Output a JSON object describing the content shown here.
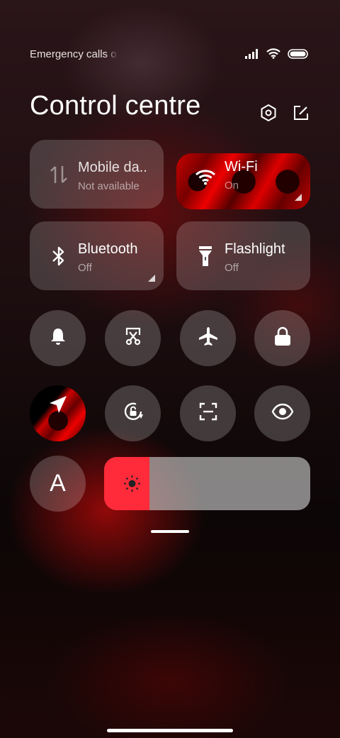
{
  "status_bar": {
    "carrier_text": "Emergency calls o",
    "icons": [
      "signal-icon",
      "wifi-icon",
      "battery-icon"
    ]
  },
  "header": {
    "title": "Control centre",
    "actions": [
      "settings-icon",
      "edit-icon"
    ]
  },
  "tiles": {
    "mobile_data": {
      "label": "Mobile da..",
      "status": "Not available"
    },
    "wifi": {
      "label": "Wi-Fi",
      "status": "On"
    },
    "bluetooth": {
      "label": "Bluetooth",
      "status": "Off"
    },
    "flashlight": {
      "label": "Flashlight",
      "status": "Off"
    }
  },
  "toggles_row1": [
    {
      "name": "ringer",
      "icon": "bell-icon"
    },
    {
      "name": "screenshot",
      "icon": "scissors-icon"
    },
    {
      "name": "airplane-mode",
      "icon": "airplane-icon"
    },
    {
      "name": "lock-screen",
      "icon": "lock-icon"
    }
  ],
  "toggles_row2": [
    {
      "name": "location",
      "icon": "location-arrow-icon",
      "active": true
    },
    {
      "name": "rotation-lock",
      "icon": "rotate-lock-icon"
    },
    {
      "name": "scanner",
      "icon": "scan-icon"
    },
    {
      "name": "reading-mode",
      "icon": "eye-icon"
    }
  ],
  "font_size_button": {
    "label": "A"
  },
  "brightness": {
    "level": 0.22,
    "icon": "sun-icon",
    "accent": "#ff2a3a"
  }
}
